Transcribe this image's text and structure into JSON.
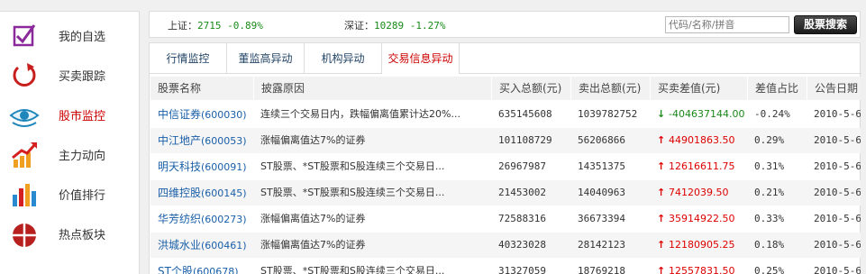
{
  "sidebar": {
    "items": [
      {
        "label": "我的自选",
        "icon": "checkbox-icon",
        "active": false
      },
      {
        "label": "买卖跟踪",
        "icon": "refresh-icon",
        "active": false
      },
      {
        "label": "股市监控",
        "icon": "eye-icon",
        "active": true
      },
      {
        "label": "主力动向",
        "icon": "trend-chart-icon",
        "active": false
      },
      {
        "label": "价值排行",
        "icon": "bar-chart-icon",
        "active": false
      },
      {
        "label": "热点板块",
        "icon": "pie-chart-icon",
        "active": false
      }
    ]
  },
  "indices": {
    "sh_label": "上证：",
    "sh_value": "2715 -0.89%",
    "sz_label": "深证：",
    "sz_value": "10289 -1.27%"
  },
  "search": {
    "placeholder": "代码/名称/拼音",
    "button": "股票搜索"
  },
  "tabs": [
    {
      "label": "行情监控",
      "active": false
    },
    {
      "label": "董监高异动",
      "active": false
    },
    {
      "label": "机构异动",
      "active": false
    },
    {
      "label": "交易信息异动",
      "active": true
    }
  ],
  "table": {
    "headers": [
      "股票名称",
      "披露原因",
      "买入总额(元)",
      "卖出总额(元)",
      "买卖差值(元)",
      "差值占比",
      "公告日期"
    ],
    "rows": [
      {
        "name": "中信证券",
        "code": "(600030)",
        "reason": "连续三个交易日内，跌幅偏离值累计达20%...",
        "buy": "635145608",
        "sell": "1039782752",
        "diff": "-404637144.00",
        "dir": "down",
        "pct": "-0.24%",
        "date": "2010-5-6"
      },
      {
        "name": "中江地产",
        "code": "(600053)",
        "reason": "涨幅偏离值达7%的证券",
        "buy": "101108729",
        "sell": "56206866",
        "diff": "44901863.50",
        "dir": "up",
        "pct": "0.29%",
        "date": "2010-5-6"
      },
      {
        "name": "明天科技",
        "code": "(600091)",
        "reason": "ST股票、*ST股票和S股连续三个交易日...",
        "buy": "26967987",
        "sell": "14351375",
        "diff": "12616611.75",
        "dir": "up",
        "pct": "0.31%",
        "date": "2010-5-6"
      },
      {
        "name": "四维控股",
        "code": "(600145)",
        "reason": "ST股票、*ST股票和S股连续三个交易日...",
        "buy": "21453002",
        "sell": "14040963",
        "diff": "7412039.50",
        "dir": "up",
        "pct": "0.21%",
        "date": "2010-5-6"
      },
      {
        "name": "华芳纺织",
        "code": "(600273)",
        "reason": "涨幅偏离值达7%的证券",
        "buy": "72588316",
        "sell": "36673394",
        "diff": "35914922.50",
        "dir": "up",
        "pct": "0.33%",
        "date": "2010-5-6"
      },
      {
        "name": "洪城水业",
        "code": "(600461)",
        "reason": "涨幅偏离值达7%的证券",
        "buy": "40323028",
        "sell": "28142123",
        "diff": "12180905.25",
        "dir": "up",
        "pct": "0.18%",
        "date": "2010-5-6"
      },
      {
        "name": "ST个股",
        "code": "(600678)",
        "reason": "ST股票、*ST股票和S股连续三个交易日...",
        "buy": "31327059",
        "sell": "18769218",
        "diff": "12557831.50",
        "dir": "up",
        "pct": "0.25%",
        "date": "2010-5-6"
      }
    ]
  },
  "colors": {
    "up": "#dd0000",
    "down": "#1a8a1a",
    "link": "#1a5fa8",
    "active_tab": "#cc0000"
  }
}
